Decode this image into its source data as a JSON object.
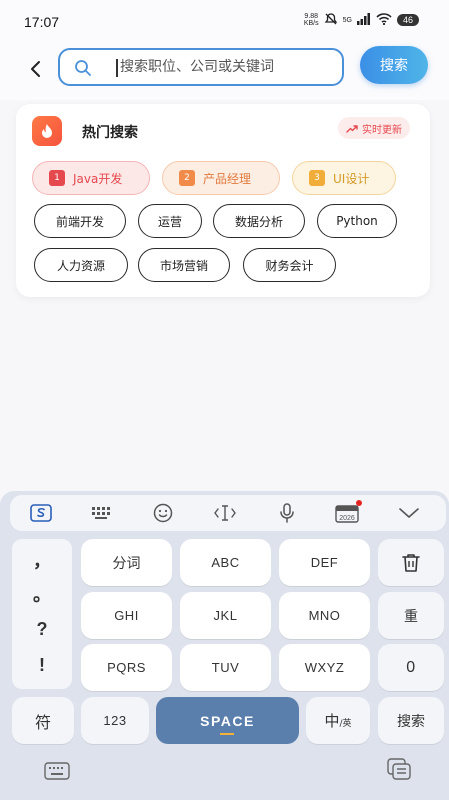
{
  "status_bar": {
    "time": "17:07",
    "net_speed_value": "9.88",
    "net_speed_unit": "KB/s",
    "network": "5G",
    "battery": "46"
  },
  "search": {
    "placeholder": "搜索职位、公司或关键词",
    "button_label": "搜索"
  },
  "hot_search": {
    "title": "热门搜索",
    "badge": "实时更新",
    "ranked": [
      {
        "rank": "1",
        "label": "Java开发"
      },
      {
        "rank": "2",
        "label": "产品经理"
      },
      {
        "rank": "3",
        "label": "UI设计"
      }
    ],
    "tags": [
      "前端开发",
      "运营",
      "数据分析",
      "Python",
      "人力资源",
      "市场营销",
      "财务会计"
    ]
  },
  "keyboard": {
    "calendar_year": "2026",
    "punctuation": [
      "，",
      "。",
      "?",
      "!"
    ],
    "rows": [
      [
        "分词",
        "ABC",
        "DEF"
      ],
      [
        "GHI",
        "JKL",
        "MNO"
      ],
      [
        "PQRS",
        "TUV",
        "WXYZ"
      ]
    ],
    "side_keys": {
      "redo": "重",
      "zero": "0"
    },
    "symbol_key": "符",
    "num_key": "123",
    "space": "SPACE",
    "lang_zh": "中",
    "lang_en": "/英",
    "search_key": "搜索"
  },
  "colors": {
    "accent_blue": "#4a90d9",
    "search_button": "#3b8fe6",
    "space_key": "#5b7fad",
    "rank1": "#e5484d",
    "rank2": "#f08b4a",
    "rank3": "#f0ad3a"
  }
}
